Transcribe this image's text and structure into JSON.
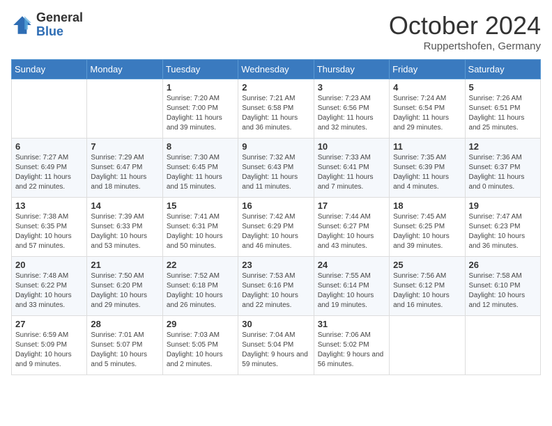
{
  "header": {
    "logo_general": "General",
    "logo_blue": "Blue",
    "month_title": "October 2024",
    "location": "Ruppertshofen, Germany"
  },
  "calendar": {
    "days_of_week": [
      "Sunday",
      "Monday",
      "Tuesday",
      "Wednesday",
      "Thursday",
      "Friday",
      "Saturday"
    ],
    "weeks": [
      [
        {
          "day": "",
          "info": ""
        },
        {
          "day": "",
          "info": ""
        },
        {
          "day": "1",
          "info": "Sunrise: 7:20 AM\nSunset: 7:00 PM\nDaylight: 11 hours and 39 minutes."
        },
        {
          "day": "2",
          "info": "Sunrise: 7:21 AM\nSunset: 6:58 PM\nDaylight: 11 hours and 36 minutes."
        },
        {
          "day": "3",
          "info": "Sunrise: 7:23 AM\nSunset: 6:56 PM\nDaylight: 11 hours and 32 minutes."
        },
        {
          "day": "4",
          "info": "Sunrise: 7:24 AM\nSunset: 6:54 PM\nDaylight: 11 hours and 29 minutes."
        },
        {
          "day": "5",
          "info": "Sunrise: 7:26 AM\nSunset: 6:51 PM\nDaylight: 11 hours and 25 minutes."
        }
      ],
      [
        {
          "day": "6",
          "info": "Sunrise: 7:27 AM\nSunset: 6:49 PM\nDaylight: 11 hours and 22 minutes."
        },
        {
          "day": "7",
          "info": "Sunrise: 7:29 AM\nSunset: 6:47 PM\nDaylight: 11 hours and 18 minutes."
        },
        {
          "day": "8",
          "info": "Sunrise: 7:30 AM\nSunset: 6:45 PM\nDaylight: 11 hours and 15 minutes."
        },
        {
          "day": "9",
          "info": "Sunrise: 7:32 AM\nSunset: 6:43 PM\nDaylight: 11 hours and 11 minutes."
        },
        {
          "day": "10",
          "info": "Sunrise: 7:33 AM\nSunset: 6:41 PM\nDaylight: 11 hours and 7 minutes."
        },
        {
          "day": "11",
          "info": "Sunrise: 7:35 AM\nSunset: 6:39 PM\nDaylight: 11 hours and 4 minutes."
        },
        {
          "day": "12",
          "info": "Sunrise: 7:36 AM\nSunset: 6:37 PM\nDaylight: 11 hours and 0 minutes."
        }
      ],
      [
        {
          "day": "13",
          "info": "Sunrise: 7:38 AM\nSunset: 6:35 PM\nDaylight: 10 hours and 57 minutes."
        },
        {
          "day": "14",
          "info": "Sunrise: 7:39 AM\nSunset: 6:33 PM\nDaylight: 10 hours and 53 minutes."
        },
        {
          "day": "15",
          "info": "Sunrise: 7:41 AM\nSunset: 6:31 PM\nDaylight: 10 hours and 50 minutes."
        },
        {
          "day": "16",
          "info": "Sunrise: 7:42 AM\nSunset: 6:29 PM\nDaylight: 10 hours and 46 minutes."
        },
        {
          "day": "17",
          "info": "Sunrise: 7:44 AM\nSunset: 6:27 PM\nDaylight: 10 hours and 43 minutes."
        },
        {
          "day": "18",
          "info": "Sunrise: 7:45 AM\nSunset: 6:25 PM\nDaylight: 10 hours and 39 minutes."
        },
        {
          "day": "19",
          "info": "Sunrise: 7:47 AM\nSunset: 6:23 PM\nDaylight: 10 hours and 36 minutes."
        }
      ],
      [
        {
          "day": "20",
          "info": "Sunrise: 7:48 AM\nSunset: 6:22 PM\nDaylight: 10 hours and 33 minutes."
        },
        {
          "day": "21",
          "info": "Sunrise: 7:50 AM\nSunset: 6:20 PM\nDaylight: 10 hours and 29 minutes."
        },
        {
          "day": "22",
          "info": "Sunrise: 7:52 AM\nSunset: 6:18 PM\nDaylight: 10 hours and 26 minutes."
        },
        {
          "day": "23",
          "info": "Sunrise: 7:53 AM\nSunset: 6:16 PM\nDaylight: 10 hours and 22 minutes."
        },
        {
          "day": "24",
          "info": "Sunrise: 7:55 AM\nSunset: 6:14 PM\nDaylight: 10 hours and 19 minutes."
        },
        {
          "day": "25",
          "info": "Sunrise: 7:56 AM\nSunset: 6:12 PM\nDaylight: 10 hours and 16 minutes."
        },
        {
          "day": "26",
          "info": "Sunrise: 7:58 AM\nSunset: 6:10 PM\nDaylight: 10 hours and 12 minutes."
        }
      ],
      [
        {
          "day": "27",
          "info": "Sunrise: 6:59 AM\nSunset: 5:09 PM\nDaylight: 10 hours and 9 minutes."
        },
        {
          "day": "28",
          "info": "Sunrise: 7:01 AM\nSunset: 5:07 PM\nDaylight: 10 hours and 5 minutes."
        },
        {
          "day": "29",
          "info": "Sunrise: 7:03 AM\nSunset: 5:05 PM\nDaylight: 10 hours and 2 minutes."
        },
        {
          "day": "30",
          "info": "Sunrise: 7:04 AM\nSunset: 5:04 PM\nDaylight: 9 hours and 59 minutes."
        },
        {
          "day": "31",
          "info": "Sunrise: 7:06 AM\nSunset: 5:02 PM\nDaylight: 9 hours and 56 minutes."
        },
        {
          "day": "",
          "info": ""
        },
        {
          "day": "",
          "info": ""
        }
      ]
    ]
  }
}
